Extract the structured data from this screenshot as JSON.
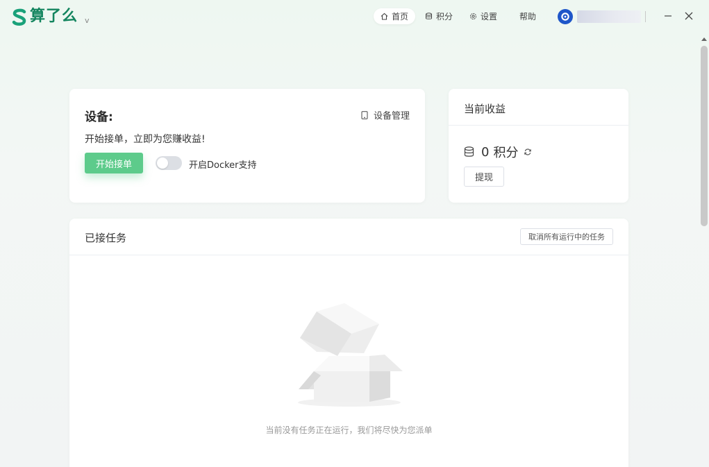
{
  "app": {
    "logo_text": "算了么",
    "version": "v"
  },
  "nav": {
    "home": "首页",
    "points": "积分",
    "settings": "设置",
    "help": "帮助"
  },
  "device_card": {
    "title": "设备:",
    "manage_label": "设备管理",
    "hint": "开始接单，立即为您赚收益!",
    "start_button": "开始接单",
    "docker_toggle_label": "开启Docker支持",
    "docker_enabled": false
  },
  "earnings_card": {
    "title": "当前收益",
    "value": "0",
    "unit": "积分",
    "withdraw_button": "提现"
  },
  "tasks_card": {
    "title": "已接任务",
    "cancel_all_button": "取消所有运行中的任务",
    "empty_text": "当前没有任务正在运行，我们将尽快为您派单"
  },
  "colors": {
    "brand": "#1aa17a",
    "primary_button": "#5dcb8b",
    "avatar": "#1e56c9"
  }
}
